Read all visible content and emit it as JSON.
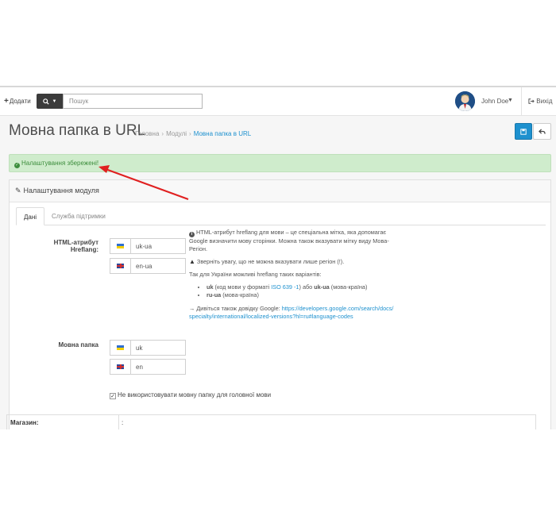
{
  "header": {
    "add_label": "Додати",
    "search_placeholder": "Пошук",
    "user_name": "John Doe",
    "logout_label": "Вихід"
  },
  "page": {
    "title": "Мовна папка в URL",
    "breadcrumb": [
      "Головна",
      "Модулі",
      "Мовна папка в URL"
    ]
  },
  "alert": {
    "text": "Налаштування збережені!",
    "color": "#3c8d3c"
  },
  "panel": {
    "heading": "Налаштування модуля",
    "tabs": [
      "Дані",
      "Служба підтримки"
    ]
  },
  "hreflang": {
    "label": "HTML-атрибут Hreflang:",
    "values": [
      "uk-ua",
      "en-ua"
    ]
  },
  "lang_folder": {
    "label": "Мовна папка",
    "values": [
      "uk",
      "en"
    ]
  },
  "help": {
    "p1": "HTML-атрибут hreflang для мови – це спеціальна мітка, яка допомагає Google визначити мову сторінки. Можна також вказувати мітку виду Мова-Регіон.",
    "p2": "Зверніть увагу, що не можна вказувати лише регіон (!).",
    "p3": "Так для України можливі hreflang таких варіантів:",
    "li1_code": "uk",
    "li1_mid": " (код мови у форматі ",
    "li1_link": "ISO 639 -1",
    "li1_or": ") або ",
    "li1_code2": "uk-ua",
    "li1_tail": " (мова-країна)",
    "li2_code": "ru-ua",
    "li2_tail": " (мова-країна)",
    "p4_prefix": "→ Дивіться також довідку Google: ",
    "p4_link": "https://developers.google.com/search/docs/specialty/international/localized-versions?hl=ru#language-codes"
  },
  "checkbox": {
    "label": "Не використовувати мовну папку для головної мови",
    "checked": true
  },
  "store": {
    "label": "Магазин:",
    "value": ":"
  },
  "colors": {
    "primary": "#1e91cf",
    "success_bg": "#cfeccc",
    "arrow": "#e02020"
  },
  "icons": [
    "plus-icon",
    "search-icon",
    "caret-down-icon",
    "logout-icon",
    "save-icon",
    "back-icon",
    "check-circle-icon",
    "pencil-icon",
    "info-circle-icon",
    "warning-icon",
    "flag-ua-icon",
    "flag-gb-icon",
    "checkbox-icon",
    "annotation-arrow"
  ]
}
